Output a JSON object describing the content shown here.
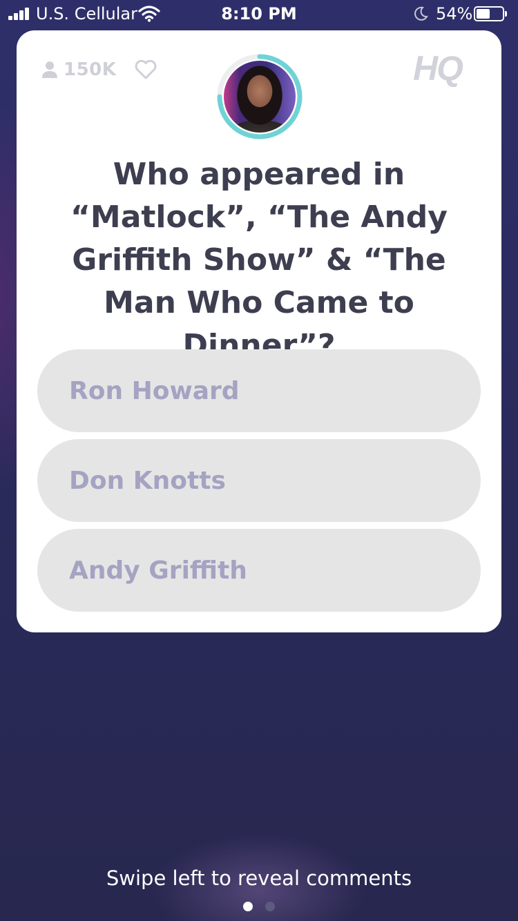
{
  "status_bar": {
    "carrier": "U.S. Cellular",
    "time": "8:10 PM",
    "battery_percent": "54%",
    "battery_level": 0.54,
    "signal_icon": "signal-bars-icon",
    "wifi_icon": "wifi-icon",
    "dnd_icon": "moon-icon"
  },
  "card": {
    "viewer_count": "150K",
    "viewer_icon": "person-icon",
    "like_icon": "heart-outline-icon",
    "logo_text": "HQ",
    "host_icon": "host-avatar",
    "timer_color": "#6fd3d6",
    "question": "Who appeared in “Matlock”, “The Andy Griffith Show” & “The Man Who Came to Dinner”?",
    "answers": [
      {
        "label": "Ron Howard"
      },
      {
        "label": "Don Knotts"
      },
      {
        "label": "Andy Griffith"
      }
    ]
  },
  "footer": {
    "hint": "Swipe left to reveal comments",
    "page_dots": 2,
    "active_page": 1
  }
}
